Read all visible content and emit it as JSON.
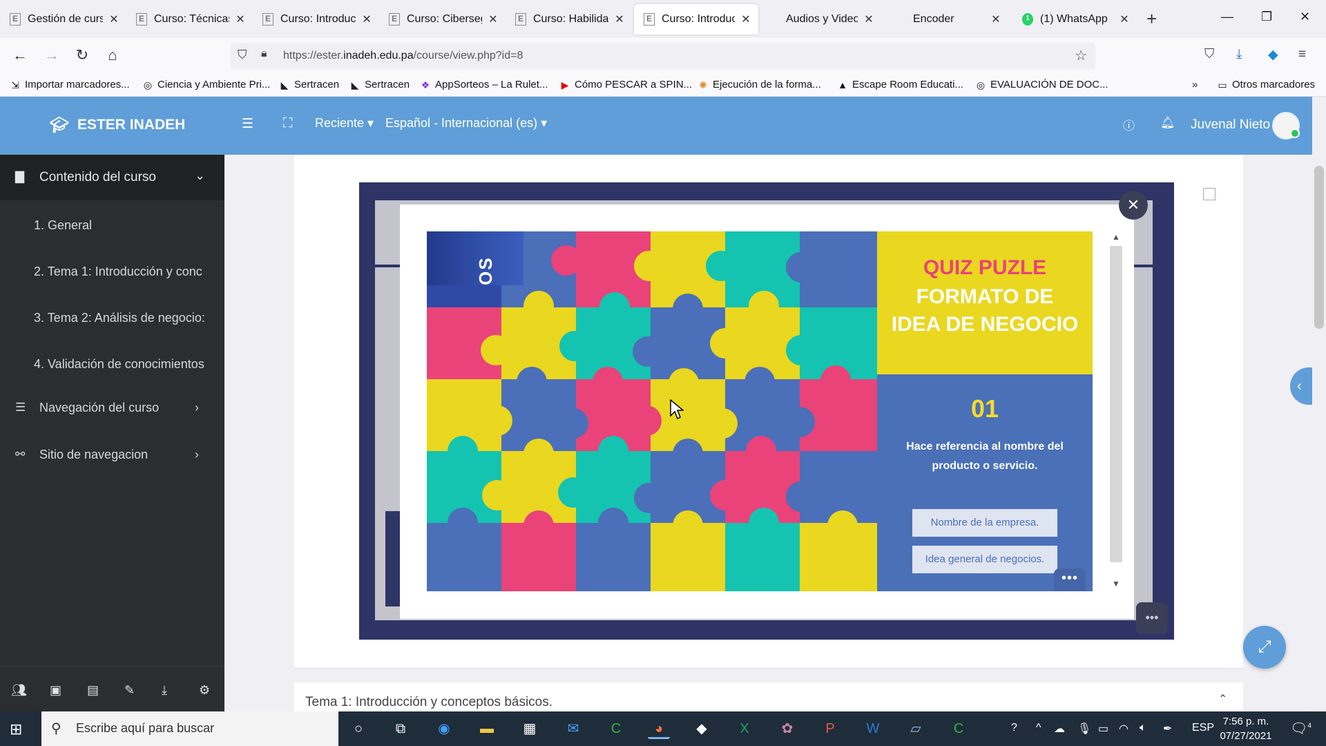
{
  "tabs": [
    {
      "label": "Gestión de curso",
      "favicon": "E"
    },
    {
      "label": "Curso: Técnicas b",
      "favicon": "E"
    },
    {
      "label": "Curso: Introducci",
      "favicon": "E"
    },
    {
      "label": "Curso: Cibersegu",
      "favicon": "E"
    },
    {
      "label": "Curso: Habilidad",
      "favicon": "E"
    },
    {
      "label": "Curso: Introducci",
      "favicon": "E"
    },
    {
      "label": "Audios y Videos ·",
      "favicon": ""
    },
    {
      "label": "Encoder",
      "favicon": ""
    },
    {
      "label": "(1) WhatsApp",
      "favicon": "1"
    }
  ],
  "url": {
    "prefix": "https://ester.",
    "domain": "inadeh.edu.pa",
    "path": "/course/view.php?id=8"
  },
  "bookmarks": [
    "Importar marcadores...",
    "Ciencia y Ambiente Pri...",
    "Sertracen",
    "Sertracen",
    "AppSorteos – La Rulet...",
    "Cómo PESCAR a SPIN...",
    "Ejecución de la forma...",
    "Escape Room Educati...",
    "EVALUACIÓN DE DOC...",
    "Otros marcadores"
  ],
  "header": {
    "brand": "ESTER INADEH",
    "recent": "Reciente",
    "language": "Español - Internacional (es)",
    "user": "Juvenal Nieto"
  },
  "drawer": {
    "heading": "Contenido del curso",
    "sections": [
      "1.  General",
      "2.  Tema 1: Introducción y conc",
      "3.  Tema 2: Análisis de negocio:",
      "4.  Validación de conocimientos"
    ],
    "nav": "Navegación del curso",
    "site": "Sitio de navegacion"
  },
  "quiz": {
    "title_line1": "QUIZ PUZLE",
    "title_line2": "FORMATO DE",
    "title_line3": "IDEA DE NEGOCIO",
    "number": "01",
    "question": "Hace referencia al nombre del producto o servicio.",
    "options": [
      "Nombre de la empresa.",
      "Idea general de negocios."
    ],
    "more": "•••",
    "vertical_label": "OS"
  },
  "content": {
    "section_title": "Tema 1: Introducción y conceptos básicos."
  },
  "taskbar": {
    "search_placeholder": "Escribe aquí para buscar",
    "language": "ESP",
    "time": "7:56 p. m.",
    "date": "07/27/2021",
    "notifications": "4"
  },
  "colors": {
    "moodle_blue": "#5f9ed8",
    "drawer_dark": "#2b2d2f",
    "quiz_yellow": "#ead71f",
    "quiz_pink": "#e9437a",
    "quiz_blue": "#4a70b8",
    "puzzle_teal": "#14c4b0"
  }
}
